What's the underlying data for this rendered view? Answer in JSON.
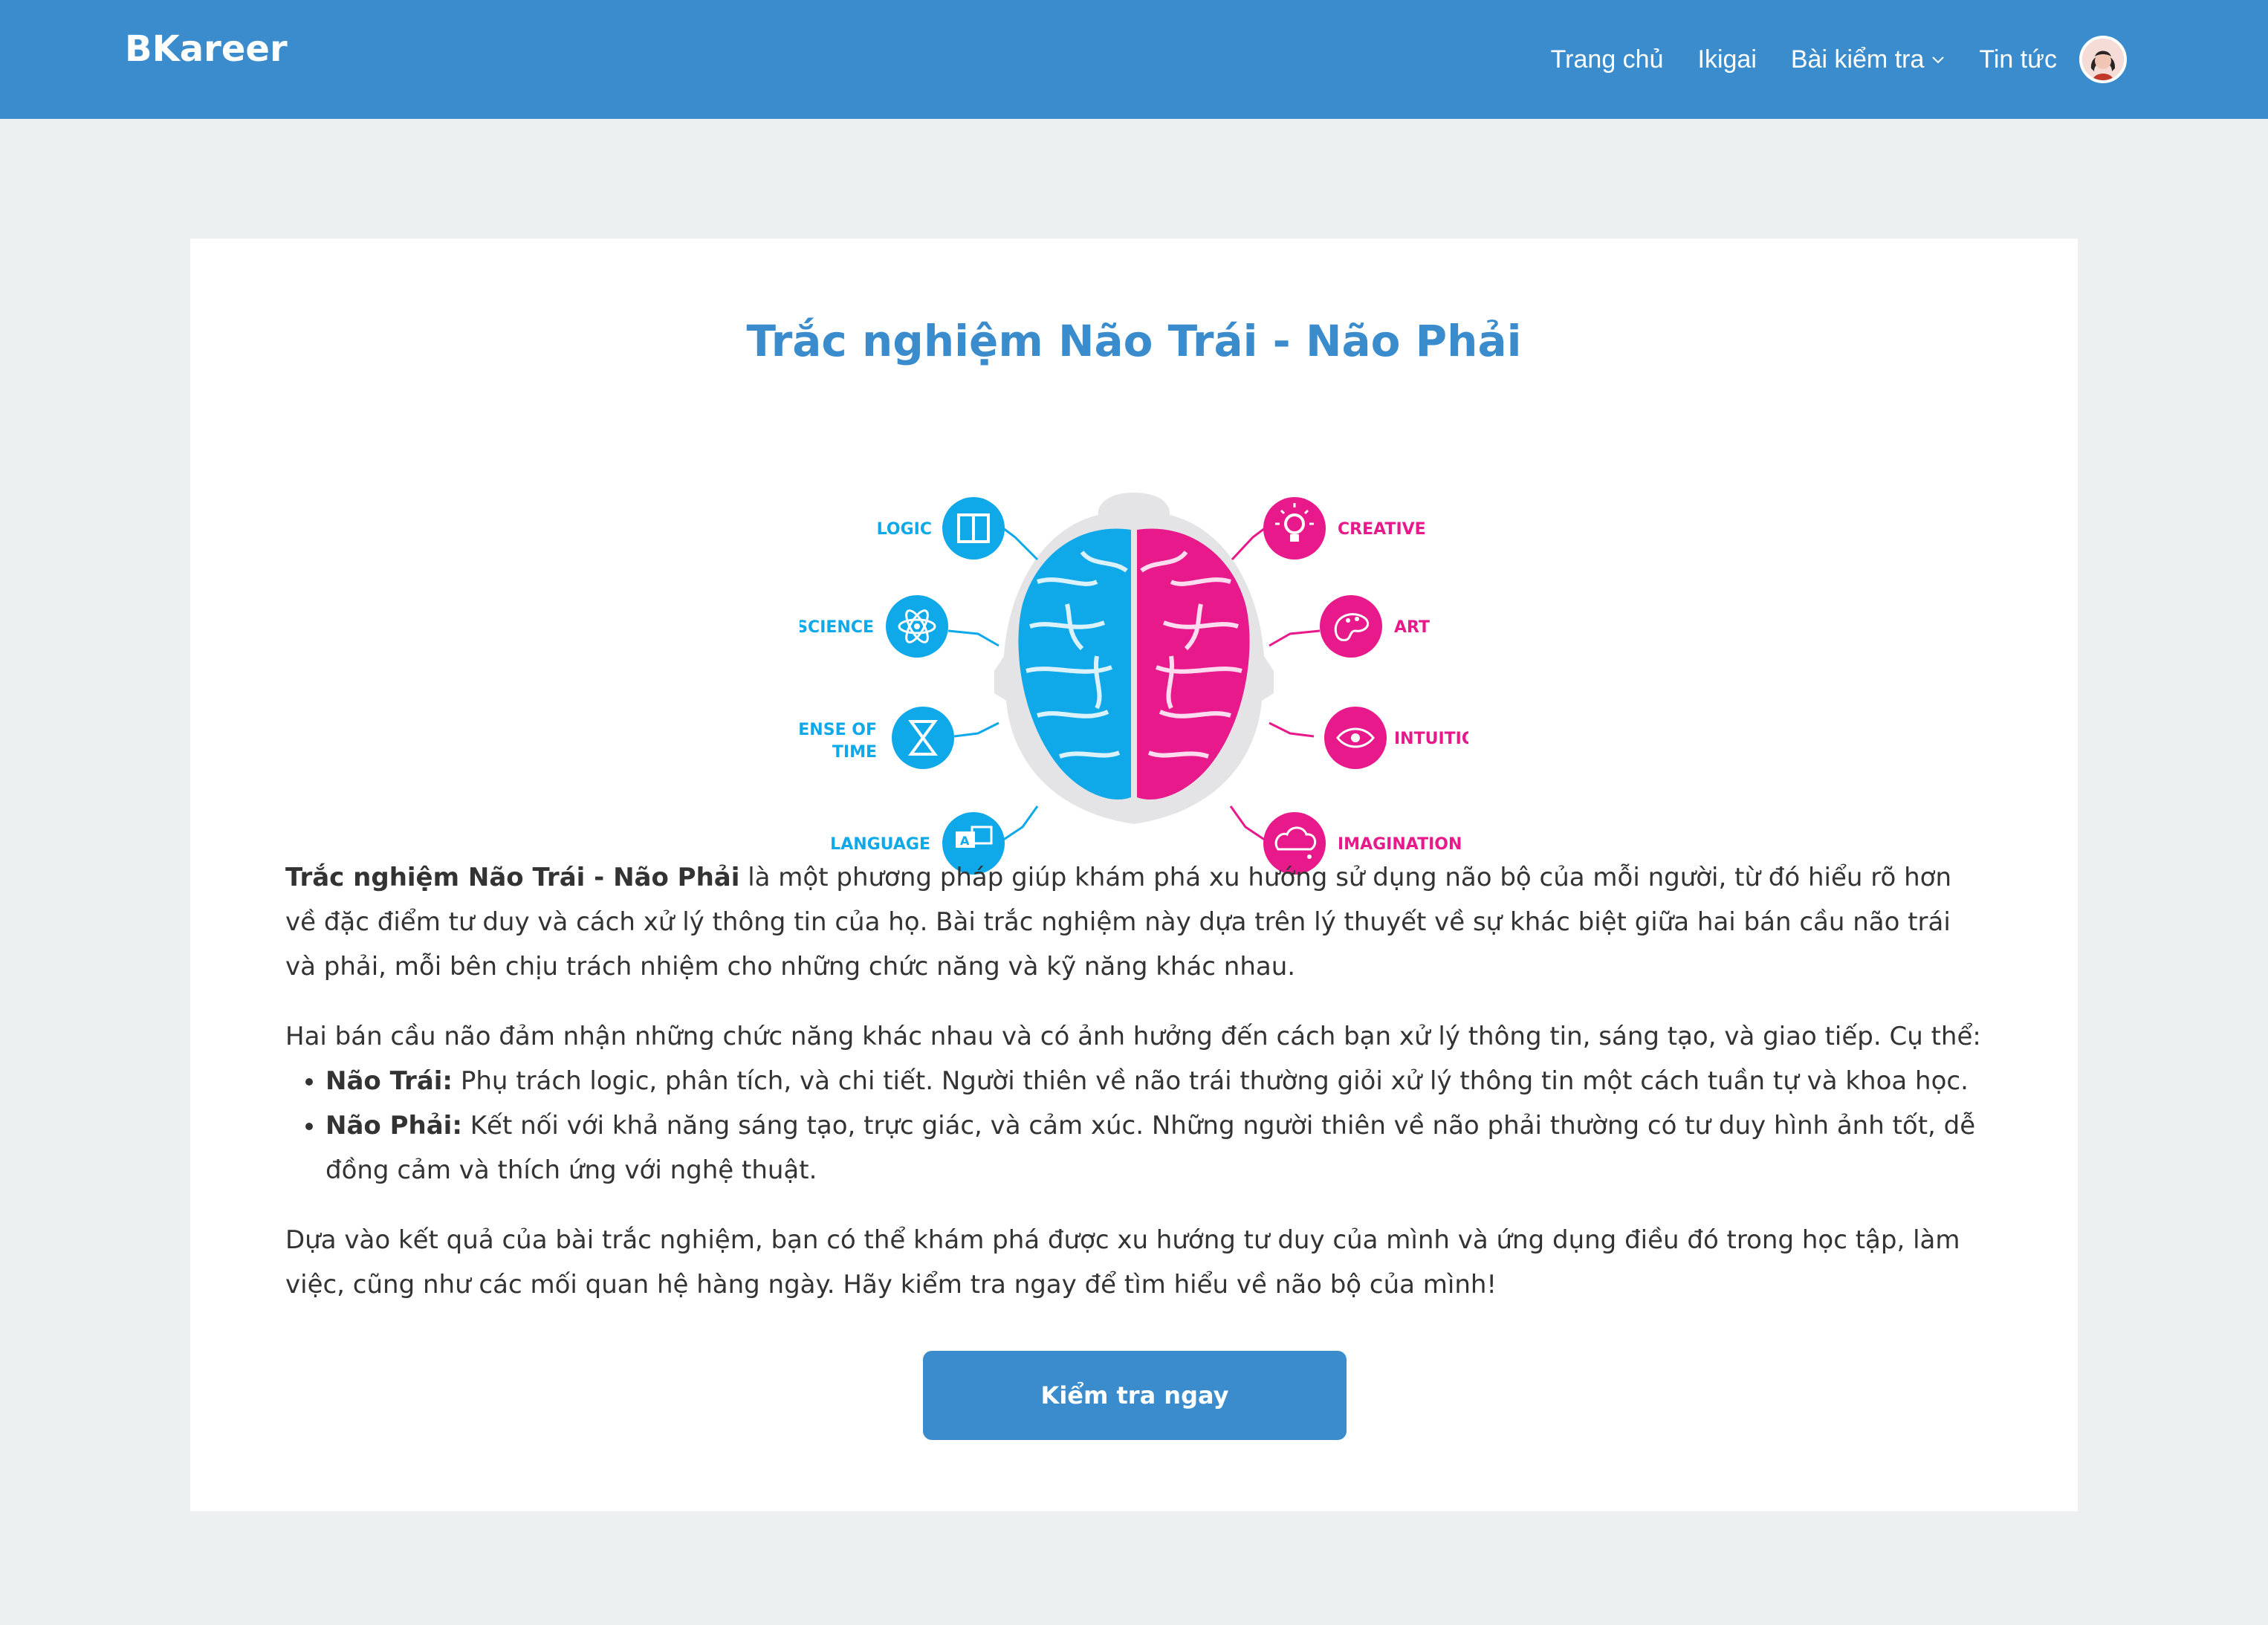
{
  "brand": {
    "name": "BKareer",
    "accent": "#3a8ccc",
    "left_color": "#0fa8e8",
    "right_color": "#e8198b"
  },
  "nav": {
    "items": [
      {
        "label": "Trang chủ"
      },
      {
        "label": "Ikigai"
      },
      {
        "label": "Bài kiểm tra",
        "icon": "chevron-down-icon"
      },
      {
        "label": "Tin tức"
      }
    ],
    "avatar_icon": "user-avatar"
  },
  "page": {
    "title": "Trắc nghiệm Não Trái - Não Phải",
    "figure_labels": {
      "left": [
        "LOGIC",
        "SCIENCE",
        "SENSE OF",
        "TIME",
        "LANGUAGE"
      ],
      "right": [
        "CREATIVE",
        "ART",
        "INTUITION",
        "IMAGINATION"
      ]
    },
    "intro": {
      "bold": "Trắc nghiệm Não Trái - Não Phải",
      "rest": " là một phương pháp giúp khám phá xu hướng sử dụng não bộ của mỗi người, từ đó hiểu rõ hơn về đặc điểm tư duy và cách xử lý thông tin của họ. Bài trắc nghiệm này dựa trên lý thuyết về sự khác biệt giữa hai bán cầu não trái và phải, mỗi bên chịu trách nhiệm cho những chức năng và kỹ năng khác nhau."
    },
    "lead": "Hai bán cầu não đảm nhận những chức năng khác nhau và có ảnh hưởng đến cách bạn xử lý thông tin, sáng tạo, và giao tiếp. Cụ thể:",
    "bullets": [
      {
        "term": "Não Trái:",
        "text": " Phụ trách logic, phân tích, và chi tiết. Người thiên về não trái thường giỏi xử lý thông tin một cách tuần tự và khoa học."
      },
      {
        "term": "Não Phải:",
        "text": " Kết nối với khả năng sáng tạo, trực giác, và cảm xúc. Những người thiên về não phải thường có tư duy hình ảnh tốt, dễ đồng cảm và thích ứng với nghệ thuật."
      }
    ],
    "closing": "Dựa vào kết quả của bài trắc nghiệm, bạn có thể khám phá được xu hướng tư duy của mình và ứng dụng điều đó trong học tập, làm việc, cũng như các mối quan hệ hàng ngày. Hãy kiểm tra ngay để tìm hiểu về não bộ của mình!",
    "cta": "Kiểm tra ngay"
  }
}
